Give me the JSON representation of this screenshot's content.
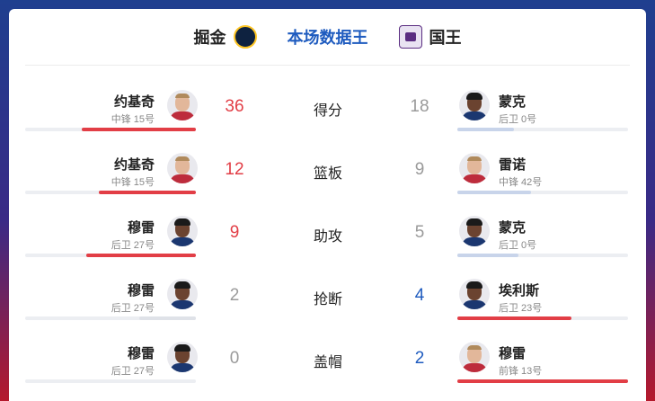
{
  "header": {
    "home_team": "掘金",
    "title": "本场数据王",
    "away_team": "国王",
    "home_logo_icon": "nuggets-logo-icon",
    "away_logo_icon": "kings-logo-icon"
  },
  "colors": {
    "home_accent": "#e23e46",
    "away_accent": "#1e5bbf",
    "away_bar": "#c8d4ea",
    "home_bar_light": "#dfe2e8",
    "muted_value": "#9a9a9a"
  },
  "rows": [
    {
      "stat": "得分",
      "left": {
        "name": "约基奇",
        "pos": "中锋 15号",
        "value": "36",
        "share": 0.67,
        "leading": true,
        "skin": "light"
      },
      "right": {
        "name": "蒙克",
        "pos": "后卫 0号",
        "value": "18",
        "share": 0.33,
        "leading": false,
        "skin": "dark"
      }
    },
    {
      "stat": "篮板",
      "left": {
        "name": "约基奇",
        "pos": "中锋 15号",
        "value": "12",
        "share": 0.57,
        "leading": true,
        "skin": "light"
      },
      "right": {
        "name": "雷诺",
        "pos": "中锋 42号",
        "value": "9",
        "share": 0.43,
        "leading": false,
        "skin": "light"
      }
    },
    {
      "stat": "助攻",
      "left": {
        "name": "穆雷",
        "pos": "后卫 27号",
        "value": "9",
        "share": 0.64,
        "leading": true,
        "skin": "dark"
      },
      "right": {
        "name": "蒙克",
        "pos": "后卫 0号",
        "value": "5",
        "share": 0.36,
        "leading": false,
        "skin": "dark"
      }
    },
    {
      "stat": "抢断",
      "left": {
        "name": "穆雷",
        "pos": "后卫 27号",
        "value": "2",
        "share": 0.33,
        "leading": false,
        "skin": "dark"
      },
      "right": {
        "name": "埃利斯",
        "pos": "后卫 23号",
        "value": "4",
        "share": 0.67,
        "leading": true,
        "skin": "dark"
      }
    },
    {
      "stat": "盖帽",
      "left": {
        "name": "穆雷",
        "pos": "后卫 27号",
        "value": "0",
        "share": 0.0,
        "leading": false,
        "skin": "dark"
      },
      "right": {
        "name": "穆雷",
        "pos": "前锋 13号",
        "value": "2",
        "share": 1.0,
        "leading": true,
        "skin": "light"
      }
    }
  ]
}
